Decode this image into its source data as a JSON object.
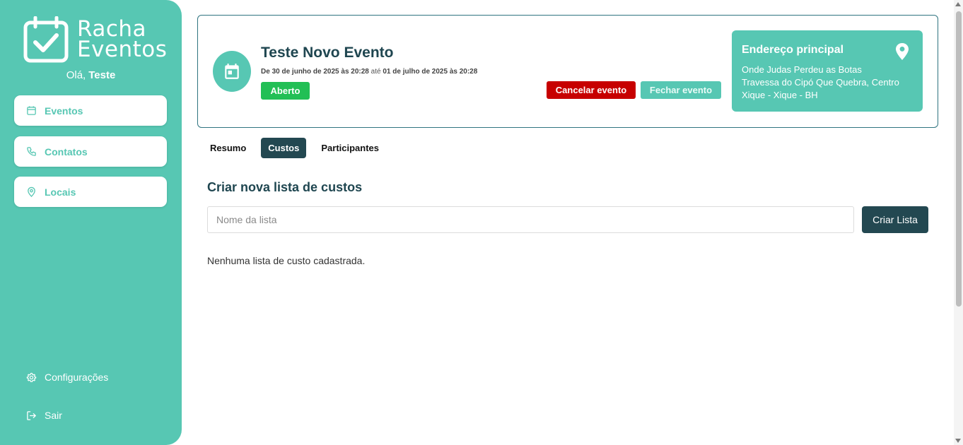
{
  "brand": {
    "line1": "Racha",
    "line2": "Eventos",
    "icon": "calendar-check-icon"
  },
  "greeting": {
    "prefix": "Olá,",
    "name": "Teste"
  },
  "sidebar": {
    "items": [
      {
        "label": "Eventos",
        "icon": "calendar-icon"
      },
      {
        "label": "Contatos",
        "icon": "phone-icon"
      },
      {
        "label": "Locais",
        "icon": "map-pin-icon"
      }
    ],
    "settings_label": "Configurações",
    "logout_label": "Sair"
  },
  "event": {
    "title": "Teste Novo Evento",
    "dates": {
      "prefix": "De",
      "start": "30 de junho de 2025 às 20:28",
      "middle": "até",
      "end": "01 de julho de 2025 às 20:28"
    },
    "status": "Aberto",
    "cancel_label": "Cancelar evento",
    "close_label": "Fechar evento"
  },
  "address": {
    "title": "Endereço principal",
    "line1": "Onde Judas Perdeu as Botas",
    "line2": "Travessa do Cipó Que Quebra, Centro",
    "line3": "Xique - Xique - BH"
  },
  "tabs": [
    {
      "label": "Resumo",
      "active": false
    },
    {
      "label": "Custos",
      "active": true
    },
    {
      "label": "Participantes",
      "active": false
    }
  ],
  "costs": {
    "section_title": "Criar nova lista de custos",
    "input_placeholder": "Nome da lista",
    "input_value": "",
    "create_label": "Criar Lista",
    "empty_message": "Nenhuma lista de custo cadastrada."
  },
  "colors": {
    "primary": "#57c7b3",
    "dark": "#234851",
    "status_open": "#22bf55",
    "danger": "#c70000"
  }
}
